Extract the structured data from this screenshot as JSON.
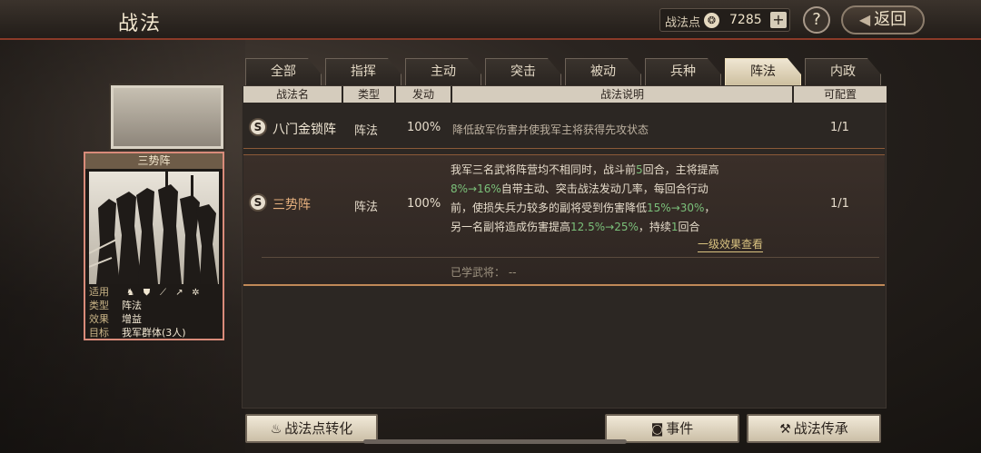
{
  "header": {
    "title": "战法"
  },
  "points": {
    "label": "战法点",
    "value": "7285",
    "plus": "+"
  },
  "help": {
    "label": "?"
  },
  "back": {
    "label": "返回",
    "arrow": "◀"
  },
  "tabs": [
    {
      "label": "全部"
    },
    {
      "label": "指挥"
    },
    {
      "label": "主动"
    },
    {
      "label": "突击"
    },
    {
      "label": "被动"
    },
    {
      "label": "兵种"
    },
    {
      "label": "阵法",
      "active": true
    },
    {
      "label": "内政"
    }
  ],
  "table": {
    "headers": [
      "战法名",
      "类型",
      "发动",
      "战法说明",
      "可配置"
    ],
    "rows": [
      {
        "badge": "S",
        "name": "八门金锁阵",
        "type": "阵法",
        "rate": "100%",
        "desc": "降低敌军伤害并使我军主将获得先攻状态",
        "config": "1/1"
      },
      {
        "badge": "S",
        "name": "三势阵",
        "type": "阵法",
        "rate": "100%",
        "desc_lines": [
          [
            "我军三名武将阵营均不相同时，战斗前",
            {
              "g": "5"
            },
            "回合，主将提高"
          ],
          [
            {
              "g": "8%→16%"
            },
            "自带主动、突击战法发动几率，每回合行动"
          ],
          [
            "前，使损失兵力较多的副将受到伤害降低",
            {
              "g": "15%→30%"
            },
            "，"
          ],
          [
            "另一名副将造成伤害提高",
            {
              "g": "12.5%→25%"
            },
            "，持续",
            {
              "g": "1"
            },
            "回合"
          ]
        ],
        "more_link": "一级效果查看",
        "learned": "已学武将： --",
        "config": "1/1"
      }
    ]
  },
  "card": {
    "name": "三势阵",
    "apply_label": "适用",
    "apply_icons": [
      "cavalry-icon",
      "shield-icon",
      "bow-icon",
      "spear-icon",
      "wheel-icon"
    ],
    "apply_glyphs": [
      "♞",
      "⛊",
      "⟋",
      "↗",
      "✲"
    ],
    "type_label": "类型",
    "type_value": "阵法",
    "effect_label": "效果",
    "effect_value": "增益",
    "target_label": "目标",
    "target_value": "我军群体(3人)"
  },
  "buttons": {
    "convert": "战法点转化",
    "event": "事件",
    "inherit": "战法传承"
  }
}
